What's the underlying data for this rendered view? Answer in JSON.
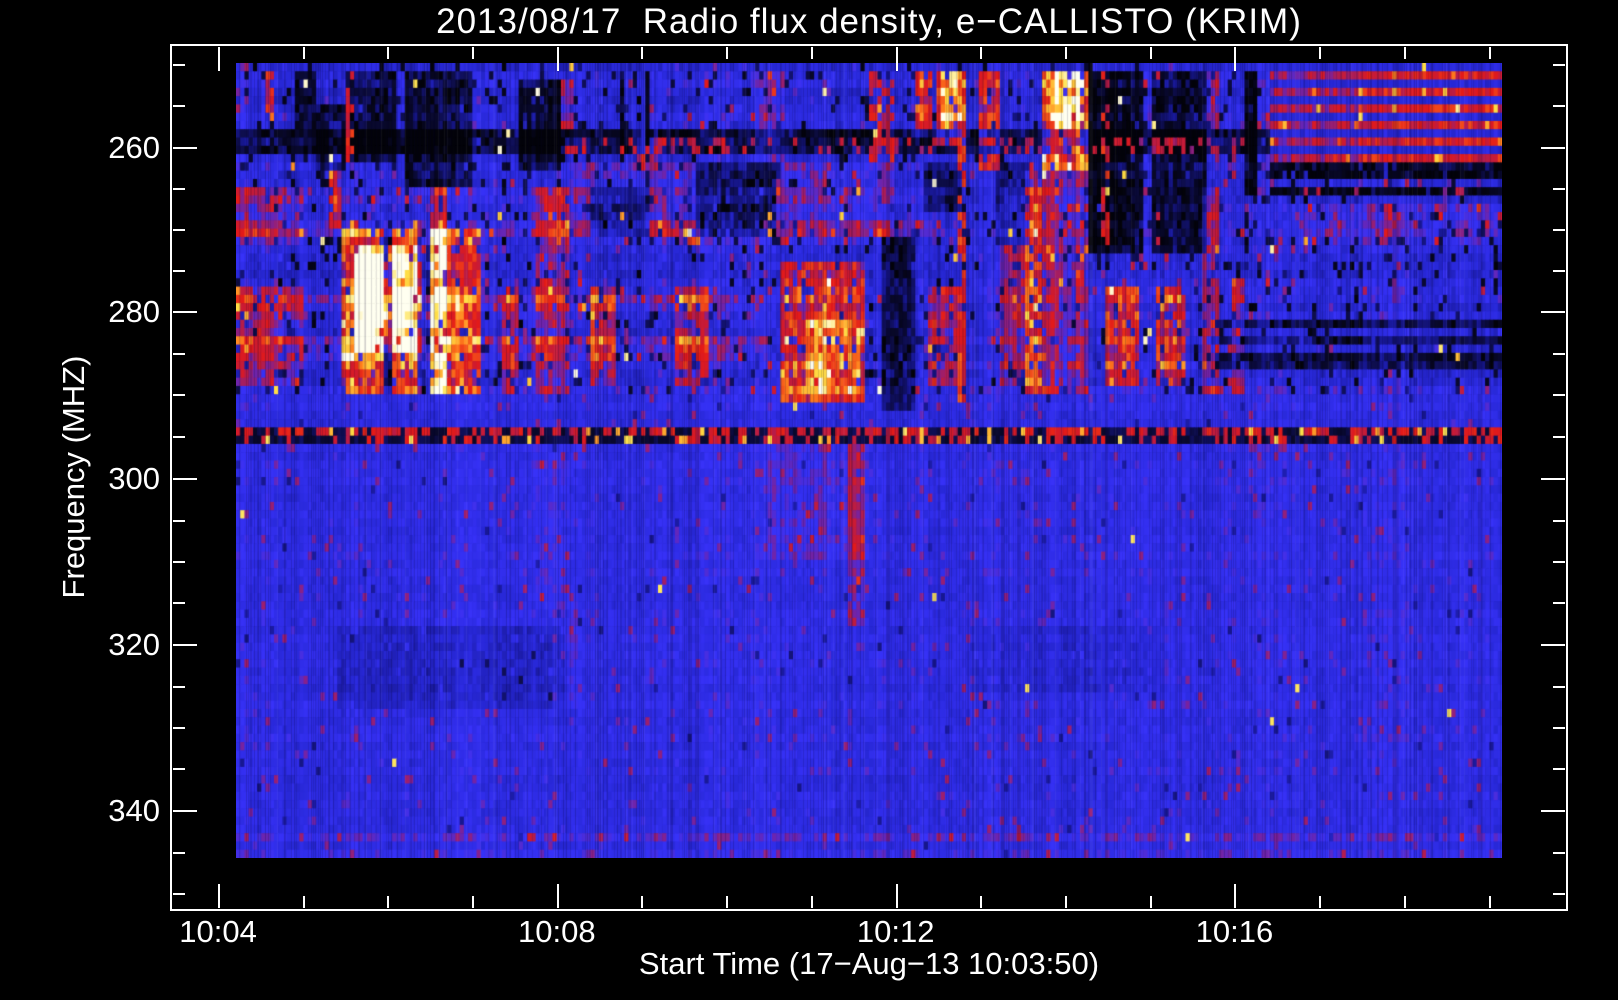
{
  "page": {
    "background": "#000000",
    "foreground": "#ffffff",
    "frame_color": "#ffffff"
  },
  "chart_data": {
    "type": "heatmap",
    "title": "2013/08/17  Radio flux density, e−CALLISTO (KRIM)",
    "xlabel": "Start Time (17−Aug−13 10:03:50)",
    "ylabel": "Frequency (MHZ)",
    "x_ticks": {
      "major": [
        {
          "label": "10:04",
          "frac": 0.0337
        },
        {
          "label": "10:08",
          "frac": 0.2764
        },
        {
          "label": "10:12",
          "frac": 0.5191
        },
        {
          "label": "10:16",
          "frac": 0.7618
        }
      ],
      "minor_fracs": [
        0.0943,
        0.155,
        0.2157,
        0.337,
        0.3977,
        0.4584,
        0.5797,
        0.6404,
        0.7011,
        0.8224,
        0.8831,
        0.9438
      ],
      "minor_interval": "1 min"
    },
    "y_ticks": {
      "major": [
        {
          "label": "260",
          "frac": 0.1179
        },
        {
          "label": "280",
          "frac": 0.3075
        },
        {
          "label": "300",
          "frac": 0.5006
        },
        {
          "label": "320",
          "frac": 0.6925
        },
        {
          "label": "340",
          "frac": 0.8844
        }
      ],
      "minor_fracs": [
        0.022,
        0.0699,
        0.1653,
        0.2127,
        0.2601,
        0.3558,
        0.404,
        0.4523,
        0.5486,
        0.5965,
        0.6445,
        0.7405,
        0.7884,
        0.8364,
        0.9324,
        0.9804
      ],
      "minor_interval": "5 MHz"
    },
    "y_axis_increasing": "downward",
    "heatmap_freq_range_mhz": [
      249.9,
      345.9
    ],
    "time_span_minutes": 15,
    "resolution": {
      "ncols": 300,
      "nrows": 96
    },
    "palette_stops": [
      [
        0.0,
        [
          3,
          3,
          10
        ]
      ],
      [
        0.14,
        [
          10,
          10,
          50
        ]
      ],
      [
        0.3,
        [
          24,
          24,
          150
        ]
      ],
      [
        0.44,
        [
          40,
          40,
          215
        ]
      ],
      [
        0.56,
        [
          55,
          50,
          248
        ]
      ],
      [
        0.62,
        [
          115,
          35,
          165
        ]
      ],
      [
        0.68,
        [
          185,
          28,
          70
        ]
      ],
      [
        0.76,
        [
          228,
          26,
          24
        ]
      ],
      [
        0.86,
        [
          255,
          125,
          28
        ]
      ],
      [
        0.94,
        [
          255,
          225,
          70
        ]
      ],
      [
        1.0,
        [
          255,
          255,
          240
        ]
      ]
    ],
    "regimes": {
      "upper_noisy_below_mhz": 290.0,
      "dotted_line_mhz": [
        294.15,
        295.45
      ],
      "stripes": {
        "t0": 0.818,
        "fmax_mhz": 262.3,
        "bright_after_t": 0.885
      }
    },
    "features": [
      [
        "d",
        0.048,
        0.063,
        250.5,
        258.0,
        -0.33
      ],
      [
        "d",
        0.063,
        0.086,
        255.0,
        263.0,
        -0.33
      ],
      [
        "d",
        0.086,
        0.126,
        250.5,
        262.0,
        -0.3
      ],
      [
        "d",
        0.117,
        0.124,
        269.5,
        290.0,
        -0.45
      ],
      [
        "d",
        0.135,
        0.186,
        251.0,
        265.0,
        -0.32
      ],
      [
        "d",
        0.145,
        0.153,
        269.5,
        290.0,
        -0.3
      ],
      [
        "d",
        0.222,
        0.256,
        251.5,
        262.5,
        -0.33
      ],
      [
        "d",
        0.279,
        0.325,
        264.5,
        270.5,
        -0.28
      ],
      [
        "d",
        0.302,
        0.307,
        250.5,
        262.0,
        -0.38
      ],
      [
        "d",
        0.322,
        0.327,
        250.5,
        262.0,
        -0.38
      ],
      [
        "d",
        0.364,
        0.425,
        261.5,
        270.5,
        -0.36
      ],
      [
        "d",
        0.51,
        0.535,
        271.0,
        292.0,
        -0.28
      ],
      [
        "d",
        0.545,
        0.572,
        262.0,
        267.5,
        -0.22
      ],
      [
        "d",
        0.6,
        0.626,
        262.0,
        272.0,
        -0.24
      ],
      [
        "d",
        0.672,
        0.717,
        250.5,
        273.0,
        -0.4
      ],
      [
        "d",
        0.722,
        0.768,
        250.5,
        272.5,
        -0.34
      ],
      [
        "d",
        0.797,
        0.807,
        250.5,
        266.0,
        -0.45
      ],
      [
        "d",
        0.818,
        1.0,
        262.4,
        263.8,
        -0.4
      ],
      [
        "d",
        0.818,
        1.0,
        264.9,
        266.3,
        -0.38
      ],
      [
        "d",
        0.775,
        1.0,
        280.6,
        282.1,
        -0.3
      ],
      [
        "d",
        0.775,
        1.0,
        282.8,
        284.2,
        -0.27
      ],
      [
        "d",
        0.775,
        1.0,
        285.1,
        286.5,
        -0.3
      ],
      [
        "d",
        0.0,
        0.818,
        257.9,
        261.2,
        -0.3
      ],
      [
        "d",
        0.08,
        0.26,
        317.5,
        327.8,
        -0.09
      ],
      [
        "d",
        0.58,
        0.73,
        317.5,
        325.5,
        -0.06
      ],
      [
        "r",
        0.0,
        0.052,
        264.5,
        272.0,
        0.12
      ],
      [
        "r",
        0.0,
        0.052,
        277.0,
        289.0,
        0.17
      ],
      [
        "r",
        0.024,
        0.031,
        250.5,
        257.0,
        0.25
      ],
      [
        "r",
        0.073,
        0.083,
        257.0,
        270.0,
        0.26
      ],
      [
        "r",
        0.085,
        0.175,
        269.5,
        290.0,
        0.3
      ],
      [
        "r",
        0.092,
        0.148,
        271.5,
        285.0,
        0.24
      ],
      [
        "r",
        0.098,
        0.128,
        272.5,
        283.0,
        0.18
      ],
      [
        "r",
        0.155,
        0.168,
        264.5,
        290.0,
        0.2
      ],
      [
        "r",
        0.176,
        0.192,
        269.5,
        290.0,
        0.24
      ],
      [
        "r",
        0.21,
        0.223,
        277.0,
        290.0,
        0.21
      ],
      [
        "r",
        0.256,
        0.268,
        251.5,
        258.0,
        0.21
      ],
      [
        "r",
        0.238,
        0.263,
        264.5,
        290.0,
        0.18
      ],
      [
        "r",
        0.28,
        0.3,
        277.0,
        288.5,
        0.21
      ],
      [
        "r",
        0.312,
        0.332,
        257.5,
        262.0,
        0.16
      ],
      [
        "r",
        0.355,
        0.366,
        269.5,
        271.5,
        0.28
      ],
      [
        "r",
        0.348,
        0.372,
        276.5,
        288.5,
        0.21
      ],
      [
        "r",
        0.43,
        0.495,
        274.0,
        290.5,
        0.27
      ],
      [
        "r",
        0.45,
        0.492,
        281.0,
        290.0,
        0.14
      ],
      [
        "r",
        0.414,
        0.432,
        250.5,
        262.0,
        0.1
      ],
      [
        "r",
        0.536,
        0.549,
        250.5,
        258.5,
        0.28
      ],
      [
        "r",
        0.552,
        0.578,
        250.5,
        260.0,
        0.33
      ],
      [
        "r",
        0.558,
        0.572,
        251.0,
        258.0,
        0.12
      ],
      [
        "r",
        0.548,
        0.578,
        276.5,
        288.5,
        0.21
      ],
      [
        "r",
        0.588,
        0.603,
        250.5,
        262.5,
        0.22
      ],
      [
        "r",
        0.605,
        0.635,
        264.5,
        288.5,
        0.16
      ],
      [
        "r",
        0.638,
        0.672,
        250.5,
        263.0,
        0.4
      ],
      [
        "r",
        0.648,
        0.668,
        251.0,
        261.0,
        0.15
      ],
      [
        "r",
        0.625,
        0.672,
        263.0,
        290.0,
        0.18
      ],
      [
        "r",
        0.688,
        0.713,
        276.5,
        289.0,
        0.26
      ],
      [
        "r",
        0.728,
        0.749,
        276.5,
        289.0,
        0.24
      ],
      [
        "r",
        0.762,
        0.776,
        264.5,
        290.0,
        0.21
      ],
      [
        "r",
        0.762,
        0.776,
        250.5,
        262.0,
        0.14
      ],
      [
        "r",
        0.787,
        0.798,
        276.0,
        290.0,
        0.21
      ],
      [
        "r",
        0.255,
        0.52,
        262.0,
        271.5,
        0.08
      ],
      [
        "r",
        0.0,
        0.56,
        264.8,
        266.4,
        0.09
      ],
      [
        "r",
        0.0,
        0.56,
        268.8,
        270.4,
        0.09
      ],
      [
        "r",
        0.0,
        0.42,
        277.5,
        280.3,
        0.11
      ],
      [
        "r",
        0.0,
        0.42,
        283.0,
        285.6,
        0.11
      ],
      [
        "r",
        0.84,
        1.0,
        266.5,
        272.0,
        0.09
      ],
      [
        "r",
        0.42,
        0.5,
        295.8,
        310.0,
        0.06
      ],
      [
        "r",
        0.485,
        0.495,
        295.8,
        318.0,
        0.11
      ],
      [
        "r",
        0.237,
        0.262,
        295.8,
        316.0,
        0.05
      ],
      [
        "r",
        0.25,
        0.27,
        315.0,
        328.0,
        0.05
      ],
      [
        "r",
        0.0,
        1.0,
        342.6,
        344.0,
        0.07
      ],
      [
        "r",
        0.0,
        1.0,
        345.2,
        346.0,
        0.05
      ],
      [
        "s",
        0.26,
        0.8,
        259.4,
        260.6,
        0.3,
        0.64
      ],
      [
        "s",
        0.818,
        1.0,
        265.0,
        266.2,
        0.12,
        0.62
      ],
      [
        "s",
        0.086,
        0.092,
        251.0,
        262.0,
        0.5,
        0.68
      ],
      [
        "s",
        0.5,
        0.521,
        250.5,
        262.0,
        0.45,
        0.66
      ],
      [
        "s",
        0.57,
        0.575,
        250.5,
        292.0,
        0.55,
        0.72
      ],
      [
        "s",
        0.684,
        0.69,
        251.0,
        272.0,
        0.5,
        0.68
      ],
      [
        "s",
        0.727,
        0.731,
        250.5,
        272.0,
        0.35,
        0.64
      ]
    ]
  }
}
